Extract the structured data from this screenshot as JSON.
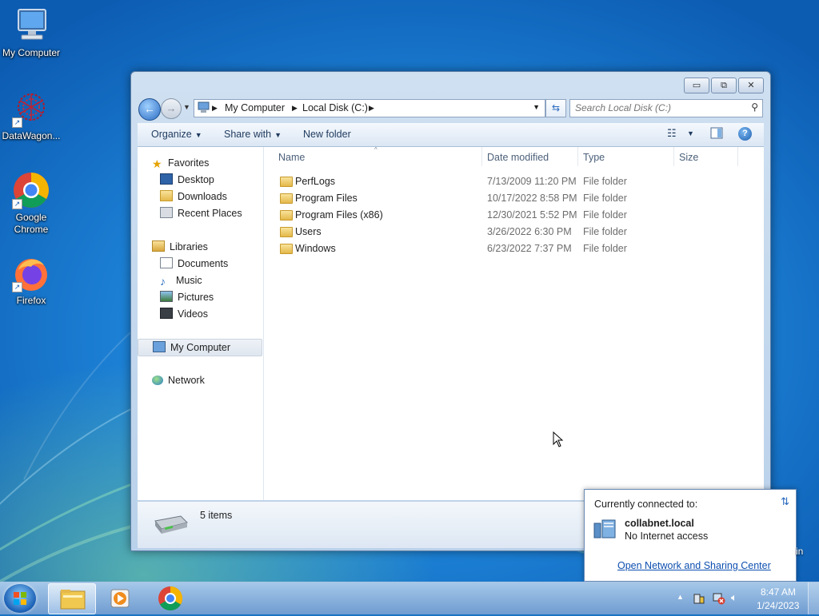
{
  "desktop": {
    "icons": [
      {
        "label": "My Computer"
      },
      {
        "label": "DataWagon..."
      },
      {
        "label": "Google Chrome"
      },
      {
        "label": "Firefox"
      }
    ]
  },
  "window": {
    "caption": {
      "minimize": "▭",
      "maximize": "⧉",
      "close": "✕"
    },
    "address": {
      "root": "My Computer",
      "current": "Local Disk (C:)"
    },
    "search": {
      "placeholder": "Search Local Disk (C:)"
    },
    "toolbar": {
      "organize": "Organize",
      "share_with": "Share with",
      "new_folder": "New folder"
    },
    "nav": {
      "favorites": "Favorites",
      "desktop": "Desktop",
      "downloads": "Downloads",
      "recent_places": "Recent Places",
      "libraries": "Libraries",
      "documents": "Documents",
      "music": "Music",
      "pictures": "Pictures",
      "videos": "Videos",
      "my_computer": "My Computer",
      "network": "Network"
    },
    "columns": {
      "name": "Name",
      "date": "Date modified",
      "type": "Type",
      "size": "Size"
    },
    "files": [
      {
        "name": "PerfLogs",
        "date": "7/13/2009 11:20 PM",
        "type": "File folder"
      },
      {
        "name": "Program Files",
        "date": "10/17/2022 8:58 PM",
        "type": "File folder"
      },
      {
        "name": "Program Files (x86)",
        "date": "12/30/2021 5:52 PM",
        "type": "File folder"
      },
      {
        "name": "Users",
        "date": "3/26/2022 6:30 PM",
        "type": "File folder"
      },
      {
        "name": "Windows",
        "date": "6/23/2022 7:37 PM",
        "type": "File folder"
      }
    ],
    "details": {
      "count": "5 items"
    }
  },
  "network_popup": {
    "header": "Currently connected to:",
    "network_name": "collabnet.local",
    "status": "No Internet access",
    "link": "Open Network and Sharing Center",
    "behind_text": "in"
  },
  "taskbar": {
    "time": "8:47 AM",
    "date": "1/24/2023"
  }
}
